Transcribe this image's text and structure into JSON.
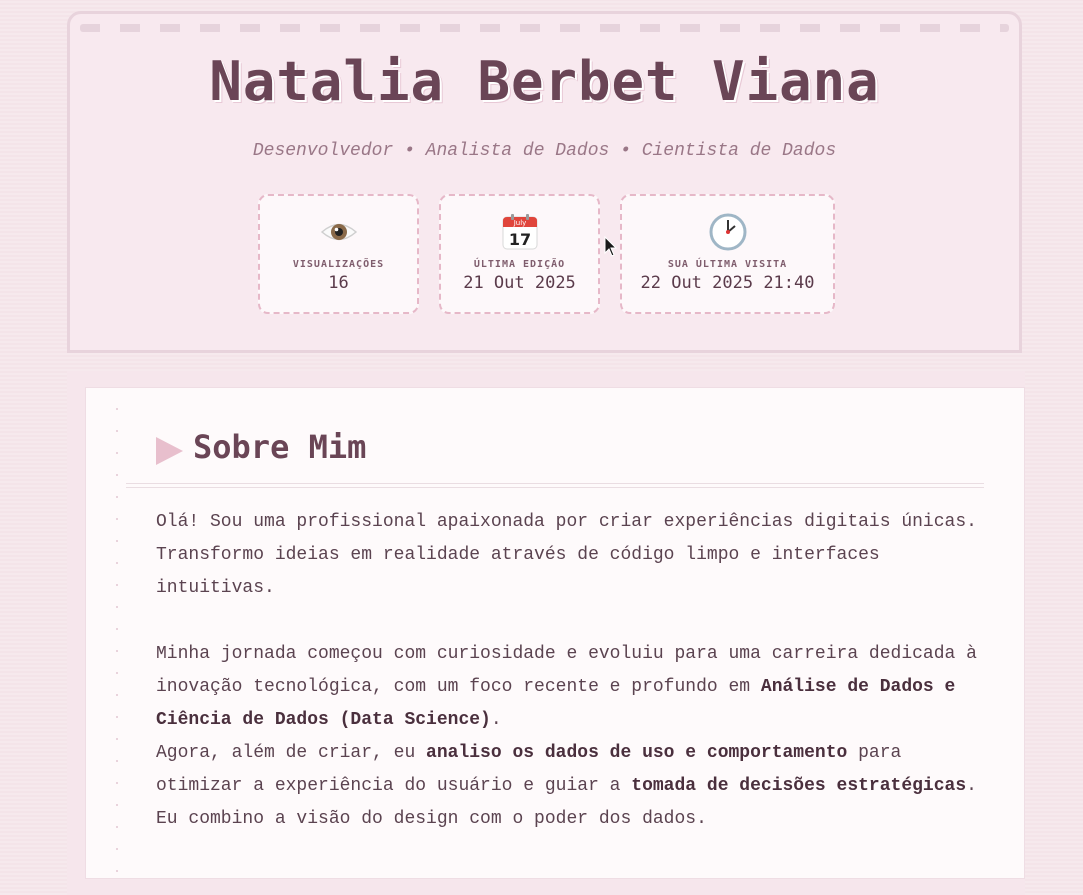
{
  "header": {
    "name": "Natalia Berbet Viana",
    "subtitle": "Desenvolvedor • Analista de Dados • Cientista de Dados",
    "stats": [
      {
        "icon": "eye-icon",
        "label": "VISUALIZAÇÕES",
        "value": "16"
      },
      {
        "icon": "calendar-icon",
        "label": "ÚLTIMA EDIÇÃO",
        "value": "21 Out 2025",
        "calendar_month": "July",
        "calendar_day": "17"
      },
      {
        "icon": "clock-icon",
        "label": "SUA ÚLTIMA VISITA",
        "value": "22 Out 2025 21:40"
      }
    ]
  },
  "about": {
    "title": "Sobre Mim",
    "p1": "Olá! Sou uma profissional apaixonada por criar experiências digitais únicas. Transformo ideias em realidade através de código limpo e interfaces intuitivas.",
    "p2_part1": "Minha jornada começou com curiosidade e evoluiu para uma carreira dedicada à inovação tecnológica, com um foco recente e profundo em ",
    "p2_bold1": "Análise de Dados e Ciência de Dados (Data Science)",
    "p2_part2": ".",
    "p3_part1": "Agora, além de criar, eu ",
    "p3_bold1": "analiso os dados de uso e comportamento",
    "p3_part2": " para otimizar a experiência do usuário e guiar a ",
    "p3_bold2": "tomada de decisões estratégicas",
    "p3_part3": ". Eu combino a visão do design com o poder dos dados."
  },
  "colors": {
    "background": "#f4e4e9",
    "title": "#6a4556",
    "accent": "#e8bfcd"
  }
}
